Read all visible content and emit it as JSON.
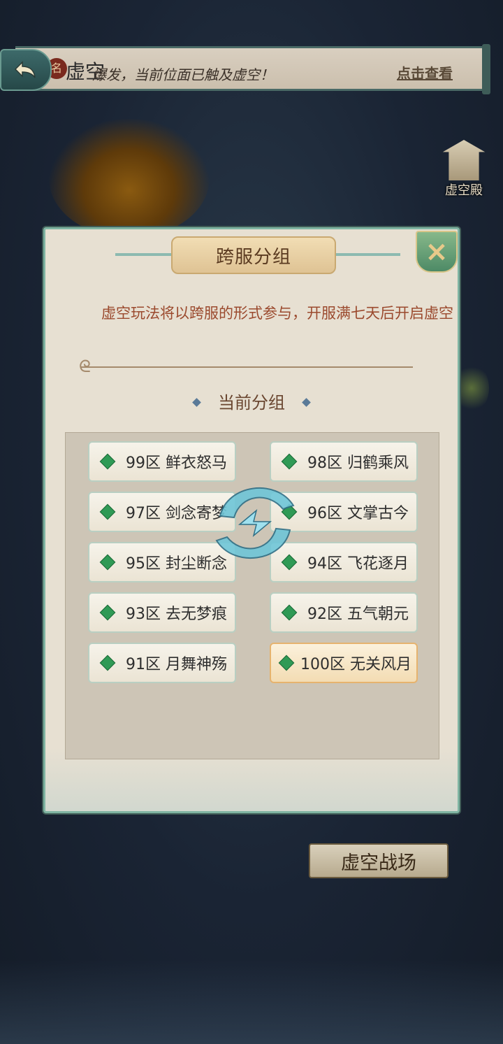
{
  "header": {
    "title": "虚空",
    "badge": "名",
    "ticker": "爆发，当前位面已触及虚空！",
    "view_link": "点击查看"
  },
  "side": {
    "palace_label": "虚空殿"
  },
  "modal": {
    "title": "跨服分组",
    "notice": "虚空玩法将以跨服的形式参与，开服满七天后开启虚空",
    "section_title": "当前分组",
    "servers": [
      {
        "name": "99区 鲜衣怒马",
        "active": false
      },
      {
        "name": "98区 归鹤乘风",
        "active": false
      },
      {
        "name": "97区 剑念寄梦",
        "active": false
      },
      {
        "name": "96区 文掌古今",
        "active": false
      },
      {
        "name": "95区 封尘断念",
        "active": false
      },
      {
        "name": "94区 飞花逐月",
        "active": false
      },
      {
        "name": "93区 去无梦痕",
        "active": false
      },
      {
        "name": "92区 五气朝元",
        "active": false
      },
      {
        "name": "91区 月舞神殇",
        "active": false
      },
      {
        "name": "100区 无关风月",
        "active": true
      }
    ]
  },
  "footer": {
    "battle_label": "虚空战场"
  },
  "colors": {
    "accent_green": "#2f9a55",
    "notice_text": "#9b4a2e",
    "modal_border": "#7fb4a2"
  }
}
